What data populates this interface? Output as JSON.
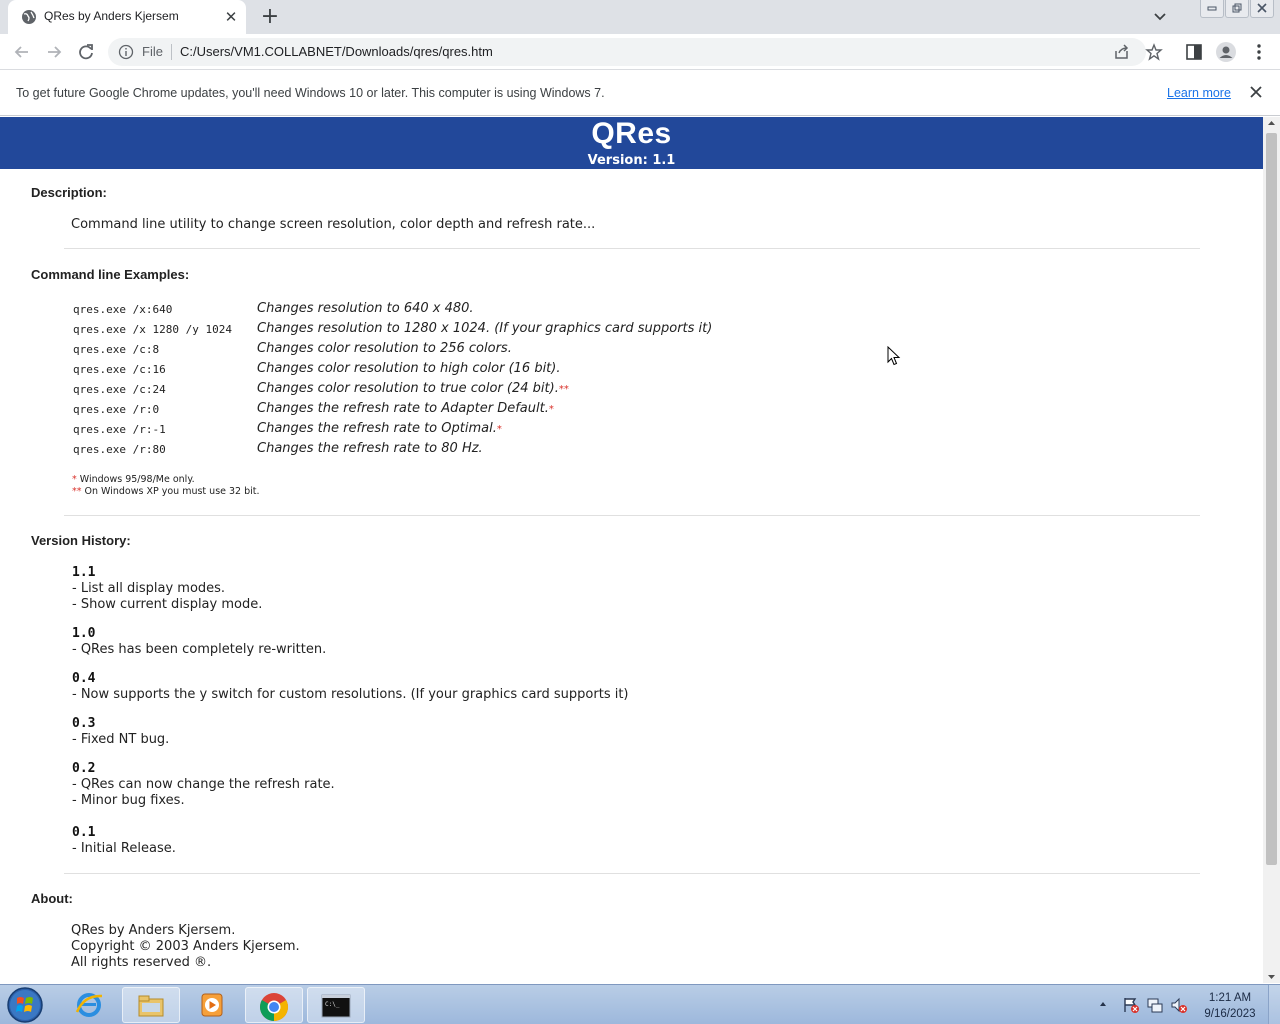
{
  "browser": {
    "tab_title": "QRes by Anders Kjersem",
    "scheme_label": "File",
    "url": "C:/Users/VM1.COLLABNET/Downloads/qres/qres.htm",
    "infobar_message": "To get future Google Chrome updates, you'll need Windows 10 or later. This computer is using Windows 7.",
    "infobar_link": "Learn more"
  },
  "page": {
    "app_name": "QRes",
    "version_label": "Version: 1.1",
    "description_title": "Description:",
    "description_text": "Command line utility to change screen resolution, color depth and refresh rate...",
    "examples_title": "Command line Examples:",
    "examples": [
      {
        "cmd": "qres.exe /x:640",
        "desc": "Changes resolution to 640 x 480.",
        "mark": ""
      },
      {
        "cmd": "qres.exe /x 1280 /y 1024",
        "desc": "Changes resolution to 1280 x 1024. (If your graphics card supports it)",
        "mark": ""
      },
      {
        "cmd": "qres.exe /c:8",
        "desc": "Changes color resolution to 256 colors.",
        "mark": ""
      },
      {
        "cmd": "qres.exe /c:16",
        "desc": "Changes color resolution to high color (16 bit).",
        "mark": ""
      },
      {
        "cmd": "qres.exe /c:24",
        "desc": "Changes color resolution to true color (24 bit).",
        "mark": "**"
      },
      {
        "cmd": "qres.exe /r:0",
        "desc": "Changes the refresh rate to Adapter Default.",
        "mark": "*"
      },
      {
        "cmd": "qres.exe /r:-1",
        "desc": "Changes the refresh rate to Optimal.",
        "mark": "*"
      },
      {
        "cmd": "qres.exe /r:80",
        "desc": "Changes the refresh rate to 80 Hz.",
        "mark": ""
      }
    ],
    "notes": [
      {
        "mark": "*",
        "text": "Windows 95/98/Me only."
      },
      {
        "mark": "**",
        "text": "On Windows XP you must use 32 bit."
      }
    ],
    "history_title": "Version History:",
    "history": [
      {
        "version": "1.1",
        "lines": [
          "- List all display modes.",
          "- Show current display mode."
        ]
      },
      {
        "version": "1.0",
        "lines": [
          "- QRes has been completely re-written."
        ]
      },
      {
        "version": "0.4",
        "lines": [
          "- Now supports the y switch for custom resolutions. (If your graphics card supports it)"
        ]
      },
      {
        "version": "0.3",
        "lines": [
          "- Fixed NT bug."
        ]
      },
      {
        "version": "0.2",
        "lines": [
          "- QRes can now change the refresh rate.",
          "- Minor bug fixes."
        ]
      },
      {
        "version": "0.1",
        "lines": [
          "- Initial Release."
        ]
      }
    ],
    "about_title": "About:",
    "about_lines": [
      "QRes by Anders Kjersem.",
      "Copyright © 2003 Anders Kjersem.",
      "All rights reserved ®."
    ]
  },
  "taskbar": {
    "time": "1:21 AM",
    "date": "9/16/2023",
    "apps": [
      "internet-explorer",
      "file-explorer",
      "media-player",
      "chrome",
      "command-prompt"
    ]
  },
  "colors": {
    "banner": "#22489a",
    "star_red": "#d9322b",
    "link_blue": "#1a73e8"
  }
}
